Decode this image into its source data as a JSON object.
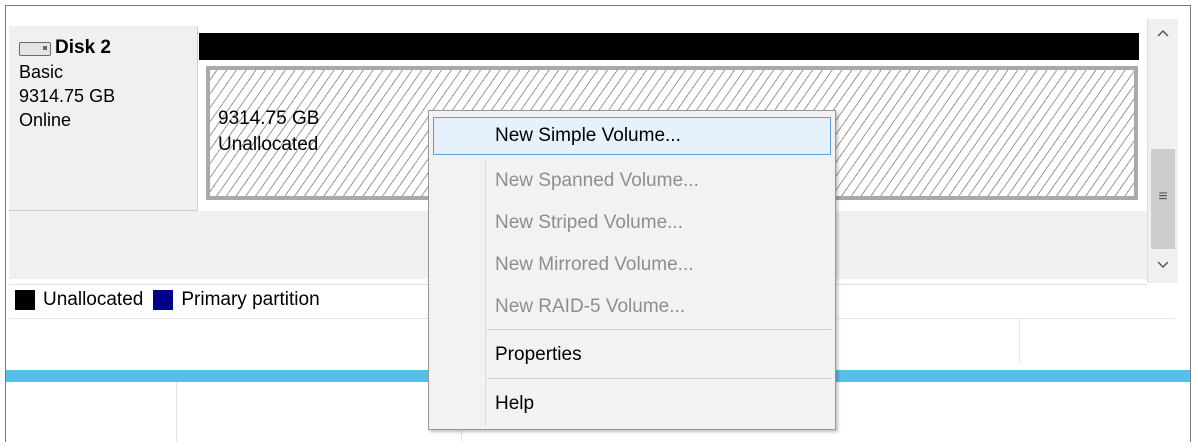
{
  "disk": {
    "name": "Disk 2",
    "type": "Basic",
    "size": "9314.75 GB",
    "status": "Online"
  },
  "volume": {
    "size": "9314.75 GB",
    "status": "Unallocated"
  },
  "legend": [
    {
      "label": "Unallocated",
      "color": "#000000"
    },
    {
      "label": "Primary partition",
      "color": "#00008b"
    }
  ],
  "scrollbar": {
    "up_icon": "chevron-up-icon",
    "down_icon": "chevron-down-icon",
    "grip_icon": "scroll-grip-icon"
  },
  "context_menu": {
    "items": [
      {
        "label": "New Simple Volume...",
        "enabled": true,
        "highlighted": true
      },
      {
        "label": "New Spanned Volume...",
        "enabled": false
      },
      {
        "label": "New Striped Volume...",
        "enabled": false
      },
      {
        "label": "New Mirrored Volume...",
        "enabled": false
      },
      {
        "label": "New RAID-5 Volume...",
        "enabled": false
      },
      {
        "label": "Properties",
        "enabled": true
      },
      {
        "label": "Help",
        "enabled": true
      }
    ]
  },
  "colors": {
    "accent_blue": "#55bfe8",
    "menu_highlight": "#e5f1fb",
    "menu_highlight_border": "#5da1d8",
    "unallocated": "#000000",
    "primary_partition": "#00008b"
  }
}
